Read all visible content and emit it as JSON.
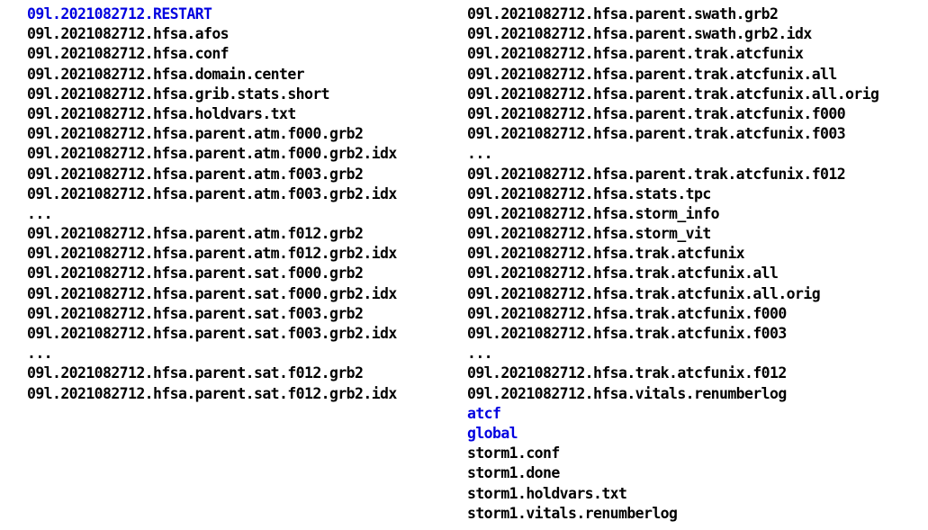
{
  "listing": {
    "left_column": [
      {
        "name": "09l.2021082712.RESTART",
        "kind": "dir"
      },
      {
        "name": "09l.2021082712.hfsa.afos",
        "kind": "file"
      },
      {
        "name": "09l.2021082712.hfsa.conf",
        "kind": "file"
      },
      {
        "name": "09l.2021082712.hfsa.domain.center",
        "kind": "file"
      },
      {
        "name": "09l.2021082712.hfsa.grib.stats.short",
        "kind": "file"
      },
      {
        "name": "09l.2021082712.hfsa.holdvars.txt",
        "kind": "file"
      },
      {
        "name": "09l.2021082712.hfsa.parent.atm.f000.grb2",
        "kind": "file"
      },
      {
        "name": "09l.2021082712.hfsa.parent.atm.f000.grb2.idx",
        "kind": "file"
      },
      {
        "name": "09l.2021082712.hfsa.parent.atm.f003.grb2",
        "kind": "file"
      },
      {
        "name": "09l.2021082712.hfsa.parent.atm.f003.grb2.idx",
        "kind": "file"
      },
      {
        "name": "...",
        "kind": "ellipsis"
      },
      {
        "name": "09l.2021082712.hfsa.parent.atm.f012.grb2",
        "kind": "file"
      },
      {
        "name": "09l.2021082712.hfsa.parent.atm.f012.grb2.idx",
        "kind": "file"
      },
      {
        "name": "09l.2021082712.hfsa.parent.sat.f000.grb2",
        "kind": "file"
      },
      {
        "name": "09l.2021082712.hfsa.parent.sat.f000.grb2.idx",
        "kind": "file"
      },
      {
        "name": "09l.2021082712.hfsa.parent.sat.f003.grb2",
        "kind": "file"
      },
      {
        "name": "09l.2021082712.hfsa.parent.sat.f003.grb2.idx",
        "kind": "file"
      },
      {
        "name": "...",
        "kind": "ellipsis"
      },
      {
        "name": "09l.2021082712.hfsa.parent.sat.f012.grb2",
        "kind": "file"
      },
      {
        "name": "09l.2021082712.hfsa.parent.sat.f012.grb2.idx",
        "kind": "file"
      }
    ],
    "right_column": [
      {
        "name": "09l.2021082712.hfsa.parent.swath.grb2",
        "kind": "file"
      },
      {
        "name": "09l.2021082712.hfsa.parent.swath.grb2.idx",
        "kind": "file"
      },
      {
        "name": "09l.2021082712.hfsa.parent.trak.atcfunix",
        "kind": "file"
      },
      {
        "name": "09l.2021082712.hfsa.parent.trak.atcfunix.all",
        "kind": "file"
      },
      {
        "name": "09l.2021082712.hfsa.parent.trak.atcfunix.all.orig",
        "kind": "file"
      },
      {
        "name": "09l.2021082712.hfsa.parent.trak.atcfunix.f000",
        "kind": "file"
      },
      {
        "name": "09l.2021082712.hfsa.parent.trak.atcfunix.f003",
        "kind": "file"
      },
      {
        "name": "...",
        "kind": "ellipsis"
      },
      {
        "name": "09l.2021082712.hfsa.parent.trak.atcfunix.f012",
        "kind": "file"
      },
      {
        "name": "09l.2021082712.hfsa.stats.tpc",
        "kind": "file"
      },
      {
        "name": "09l.2021082712.hfsa.storm_info",
        "kind": "file"
      },
      {
        "name": "09l.2021082712.hfsa.storm_vit",
        "kind": "file"
      },
      {
        "name": "09l.2021082712.hfsa.trak.atcfunix",
        "kind": "file"
      },
      {
        "name": "09l.2021082712.hfsa.trak.atcfunix.all",
        "kind": "file"
      },
      {
        "name": "09l.2021082712.hfsa.trak.atcfunix.all.orig",
        "kind": "file"
      },
      {
        "name": "09l.2021082712.hfsa.trak.atcfunix.f000",
        "kind": "file"
      },
      {
        "name": "09l.2021082712.hfsa.trak.atcfunix.f003",
        "kind": "file"
      },
      {
        "name": "...",
        "kind": "ellipsis"
      },
      {
        "name": "09l.2021082712.hfsa.trak.atcfunix.f012",
        "kind": "file"
      },
      {
        "name": "09l.2021082712.hfsa.vitals.renumberlog",
        "kind": "file"
      },
      {
        "name": "atcf",
        "kind": "dir"
      },
      {
        "name": "global",
        "kind": "dir"
      },
      {
        "name": "storm1.conf",
        "kind": "file"
      },
      {
        "name": "storm1.done",
        "kind": "file"
      },
      {
        "name": "storm1.holdvars.txt",
        "kind": "file"
      },
      {
        "name": "storm1.vitals.renumberlog",
        "kind": "file"
      }
    ]
  },
  "colors": {
    "directory": "#0000e0",
    "file": "#000000",
    "background": "#ffffff"
  }
}
